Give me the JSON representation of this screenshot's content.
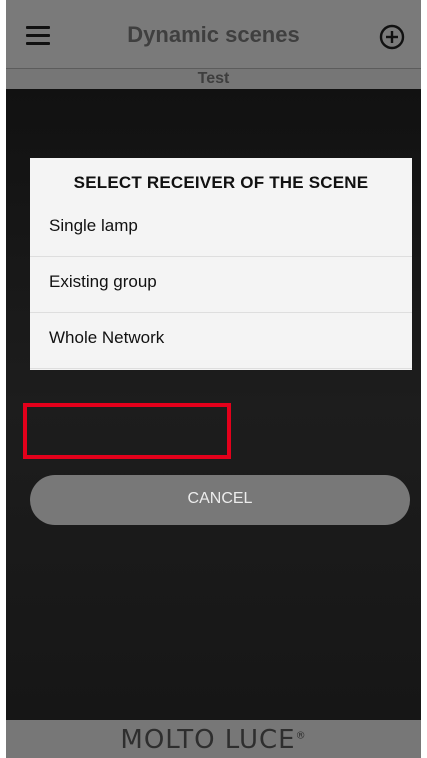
{
  "header": {
    "title": "Dynamic scenes",
    "menu_icon": "hamburger-menu-icon",
    "add_icon": "circle-plus-icon"
  },
  "subheader": {
    "scene_name": "Test"
  },
  "dialog": {
    "title": "SELECT RECEIVER OF THE SCENE",
    "options": [
      {
        "label": "Single lamp"
      },
      {
        "label": "Existing group"
      },
      {
        "label": "Whole Network"
      }
    ],
    "cancel_label": "CANCEL"
  },
  "footer": {
    "brand": "MOLTO LUCE",
    "brand_mark": "®"
  },
  "colors": {
    "header_bg": "#7a7a7a",
    "content_bg": "#141414",
    "dialog_bg": "#f4f4f4",
    "button_bg": "#787878",
    "highlight": "#e3001b"
  }
}
